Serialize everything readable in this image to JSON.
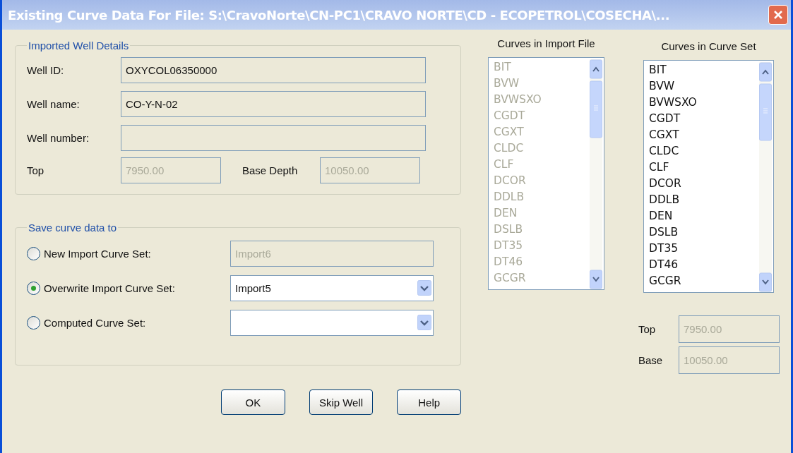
{
  "window": {
    "title": "Existing Curve Data For File: S:\\CravoNorte\\CN-PC1\\CRAVO NORTE\\CD - ECOPETROL\\COSECHA\\..."
  },
  "well_details": {
    "legend": "Imported Well Details",
    "fields": [
      {
        "label": "Well ID:",
        "value": "OXYCOL06350000"
      },
      {
        "label": "Well name:",
        "value": "CO-Y-N-02"
      },
      {
        "label": "Well number:"
      }
    ],
    "depths": [
      {
        "label": "Top",
        "value": "7950.00",
        "disabled": true
      },
      {
        "label": "Base Depth",
        "value": "10050.00",
        "disabled": true
      }
    ]
  },
  "save_to": {
    "legend": "Save curve data to",
    "options": [
      {
        "label": "New Import Curve Set:",
        "selected": false,
        "kind": "text",
        "value": "Import6",
        "disabled": true
      },
      {
        "label": "Overwrite Import Curve Set:",
        "selected": true,
        "kind": "dropdown",
        "value": "Import5",
        "disabled": false
      },
      {
        "label": "Computed Curve Set:",
        "selected": false,
        "kind": "dropdown",
        "disabled": false
      }
    ]
  },
  "lists": [
    {
      "title": "Curves in Import File",
      "disabled": true,
      "items": [
        "BIT",
        "BVW",
        "BVWSXO",
        "CGDT",
        "CGXT",
        "CLDC",
        "CLF",
        "DCOR",
        "DDLB",
        "DEN",
        "DSLB",
        "DT35",
        "DT46",
        "GCGR"
      ]
    },
    {
      "title": "Curves in Curve Set",
      "disabled": false,
      "items": [
        "BIT",
        "BVW",
        "BVWSXO",
        "CGDT",
        "CGXT",
        "CLDC",
        "CLF",
        "DCOR",
        "DDLB",
        "DEN",
        "DSLB",
        "DT35",
        "DT46",
        "GCGR"
      ]
    }
  ],
  "curve_set_depths": [
    {
      "label": "Top",
      "value": "7950.00",
      "disabled": true
    },
    {
      "label": "Base",
      "value": "10050.00",
      "disabled": true
    }
  ],
  "buttons": [
    "OK",
    "Skip Well",
    "Help"
  ]
}
